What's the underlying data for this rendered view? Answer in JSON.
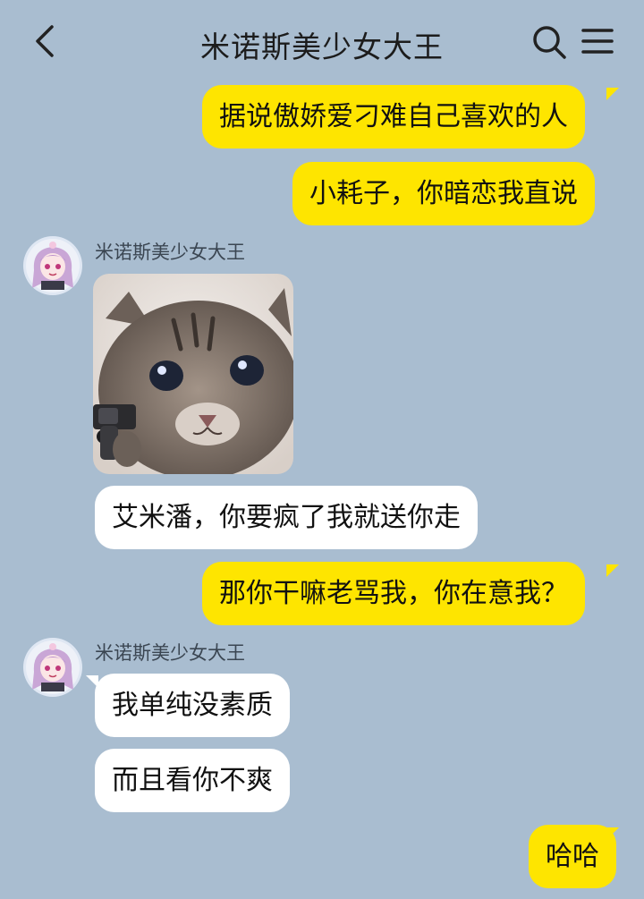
{
  "header": {
    "title": "米诺斯美少女大王",
    "back_icon": "chevron-left-icon",
    "search_icon": "search-icon",
    "menu_icon": "menu-icon"
  },
  "colors": {
    "background": "#a9bdd0",
    "outgoing_bubble": "#fee500",
    "incoming_bubble": "#ffffff"
  },
  "messages": {
    "m1": {
      "text": "据说傲娇爱刁难自己喜欢的人"
    },
    "m2": {
      "text": "小耗子，你暗恋我直说"
    },
    "m3": {
      "sender": "米诺斯美少女大王",
      "image": "kitten-with-gun-sticker"
    },
    "m4": {
      "text": "艾米潘，你要疯了我就送你走"
    },
    "m5": {
      "text": "那你干嘛老骂我，你在意我？"
    },
    "m6": {
      "sender": "米诺斯美少女大王",
      "text": "我单纯没素质"
    },
    "m7": {
      "text": "而且看你不爽"
    },
    "m8": {
      "text": "哈哈"
    }
  }
}
